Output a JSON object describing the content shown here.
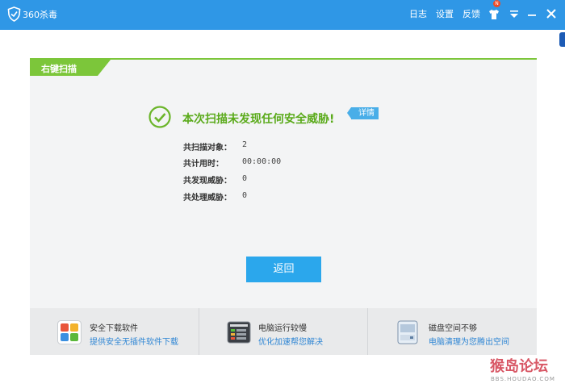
{
  "app": {
    "title": "360杀毒"
  },
  "toolbar": {
    "log": "日志",
    "settings": "设置",
    "feedback": "反馈",
    "badge": "N"
  },
  "tab": {
    "label": "右键扫描"
  },
  "result": {
    "title": "本次扫描未发现任何安全威胁!",
    "detail": "详情",
    "stats": [
      {
        "label": "共扫描对象：",
        "value": "2"
      },
      {
        "label": "共计用时：",
        "value": "00:00:00"
      },
      {
        "label": "共发现威胁：",
        "value": "0"
      },
      {
        "label": "共处理威胁：",
        "value": "0"
      }
    ]
  },
  "back_button": "返回",
  "tips": [
    {
      "title": "安全下载软件",
      "link": "提供安全无插件软件下载",
      "icon": "software-grid-icon"
    },
    {
      "title": "电脑运行较慢",
      "link": "优化加速帮您解决",
      "icon": "speedup-icon"
    },
    {
      "title": "磁盘空间不够",
      "link": "电脑清理为您腾出空间",
      "icon": "disk-cleanup-icon"
    }
  ],
  "watermark": {
    "main": "猴岛论坛",
    "sub": "BBS.HOUDAO.COM"
  },
  "colors": {
    "titlebar": "#2f97e6",
    "accent_green": "#7cc63a",
    "success_text": "#5aaa1a",
    "button": "#2ba7ec",
    "link": "#2f86d4"
  }
}
